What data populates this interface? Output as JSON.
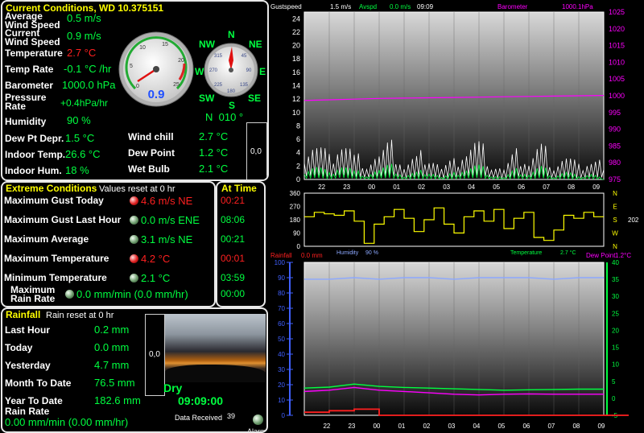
{
  "current": {
    "title": "Current Conditions, WD 10.375151",
    "avg_wind_label": "Average\nWind Speed",
    "avg_wind_value": "0.5 m/s",
    "cur_wind_label": "Current\nWind Speed",
    "cur_wind_value": "0.9 m/s",
    "temp_label": "Temperature",
    "temp_value": "2.7 °C",
    "temp_rate_label": "Temp Rate",
    "temp_rate_value": "-0.1 °C /hr",
    "baro_label": "Barometer",
    "baro_value": "1000.0 hPa",
    "pressure_rate_label": "Pressure\nRate",
    "pressure_rate_value": "+0.4hPa/hr",
    "humidity_label": "Humidity",
    "humidity_value": "90 %",
    "wind_dir_value": "N  010 °",
    "dewpt_label": "Dew Pt Depr.",
    "dewpt_value": "1.5 °C",
    "indoor_temp_label": "Indoor Temp.",
    "indoor_temp_value": "26.6 °C",
    "indoor_hum_label": "Indoor Hum.",
    "indoor_hum_value": "18 %",
    "wind_chill_label": "Wind chill",
    "wind_chill_value": "2.7 °C",
    "dew_point_label": "Dew Point",
    "dew_point_value": "1.2 °C",
    "wet_bulb_label": "Wet Bulb",
    "wet_bulb_value": "2.1 °C",
    "small_box_value": "0,0",
    "speed_gauge_value": "0.9",
    "speed_gauge_ticks": [
      "0",
      "5",
      "10",
      "15",
      "20",
      "25"
    ],
    "compass": {
      "n": "N",
      "ne": "NE",
      "e": "E",
      "se": "SE",
      "s": "S",
      "sw": "SW",
      "w": "W",
      "nw": "NW",
      "ticks": [
        "315",
        "45",
        "135",
        "225",
        "270",
        "90",
        "180"
      ]
    }
  },
  "extremes": {
    "title": "Extreme Conditions",
    "subtitle": "Values reset at 0 hr",
    "at_time_title": "At Time",
    "rows": [
      {
        "label": "Maximum Gust Today",
        "value": "4.6 m/s NE",
        "time": "00:21",
        "alert": true
      },
      {
        "label": "Maximum Gust Last Hour",
        "value": "0.0 m/s ENE",
        "time": "08:06",
        "alert": false
      },
      {
        "label": "Maximum Average",
        "value": "3.1 m/s NE",
        "time": "00:21",
        "alert": false
      },
      {
        "label": "Maximum Temperature",
        "value": "4.2 °C",
        "time": "00:01",
        "alert": true
      },
      {
        "label": "Minimum Temperature",
        "value": "2.1 °C",
        "time": "03:59",
        "alert": false
      },
      {
        "label": "Maximum\nRain Rate",
        "value": "0.0 mm/min (0.0 mm/hr)",
        "time": "00:00",
        "alert": false
      }
    ]
  },
  "rainfall": {
    "title": "Rainfall",
    "subtitle": "Rain reset at 0 hr",
    "last_hour_label": "Last Hour",
    "last_hour_value": "0.2 mm",
    "today_label": "Today",
    "today_value": "0.0 mm",
    "yesterday_label": "Yesterday",
    "yesterday_value": "4.7 mm",
    "month_label": "Month To Date",
    "month_value": "76.5 mm",
    "year_label": "Year To Date",
    "year_value": "182.6 mm",
    "rate_label": "Rain Rate",
    "rate_value": "0.00 mm/min (0.00 mm/hr)",
    "small_box_value": "0,0",
    "status": "Dry",
    "time": "09:09:00",
    "data_received_label": "Data Received",
    "data_received_value": "39",
    "alarm_label": "Alarm"
  },
  "colors": {
    "green": "#00ff40",
    "yellow": "#ffff00",
    "magenta": "#ff00ff",
    "red": "#ff2020",
    "blue": "#4060ff",
    "lightblue": "#8ca8ff"
  },
  "chart_data": [
    {
      "type": "line",
      "name": "wind-barometer",
      "legend": {
        "gust": "Gustspeed",
        "gust_value": "1.5 m/s",
        "avg": "Avspd",
        "avg_value": "0.0 m/s",
        "time": "09:09",
        "baro": "Barometer",
        "baro_value": "1000.1hPa"
      },
      "x_ticks": [
        "22",
        "23",
        "00",
        "01",
        "02",
        "03",
        "04",
        "05",
        "06",
        "07",
        "08",
        "09"
      ],
      "y_left": [
        0,
        2,
        4,
        6,
        8,
        10,
        12,
        14,
        16,
        18,
        20,
        22,
        24
      ],
      "y_right": [
        975,
        980,
        985,
        990,
        995,
        1000,
        1005,
        1010,
        1015,
        1020,
        1025
      ],
      "ylim_left": [
        0,
        25
      ],
      "ylim_right": [
        975,
        1025
      ],
      "series": [
        {
          "name": "Barometer",
          "axis": "right",
          "values": [
            998.6,
            998.8,
            999.0,
            999.2,
            999.3,
            999.4,
            999.5,
            999.6,
            999.7,
            999.8,
            999.9,
            1000.0,
            1000.1
          ]
        },
        {
          "name": "Gustspeed",
          "axis": "left",
          "values": [
            2.5,
            3.0,
            1.8,
            3.5,
            2.0,
            1.5,
            2.2,
            2.8,
            1.2,
            1.9,
            2.4,
            1.0,
            1.5,
            2.7,
            3.1,
            1.4,
            0.9,
            2.2,
            1.6,
            2.9,
            1.3,
            2.0,
            1.1,
            1.8,
            1.5
          ]
        },
        {
          "name": "Avspd",
          "axis": "left",
          "values": [
            0.8,
            1.2,
            0.5,
            1.4,
            0.7,
            0.4,
            0.9,
            1.1,
            0.3,
            0.6,
            0.8,
            0.2,
            0.5,
            1.0,
            1.2,
            0.4,
            0.2,
            0.8,
            0.5,
            1.1,
            0.3,
            0.7,
            0.2,
            0.6,
            0.0
          ]
        }
      ]
    },
    {
      "type": "line",
      "name": "wind-direction",
      "y_left": [
        0,
        90,
        180,
        270,
        360
      ],
      "y_right": [
        "N",
        "W",
        "S",
        "E",
        "N"
      ],
      "right_value": "202",
      "ylim": [
        0,
        360
      ],
      "series": [
        {
          "name": "Direction",
          "values": [
            200,
            230,
            220,
            210,
            240,
            170,
            20,
            150,
            200,
            250,
            190,
            100,
            180,
            260,
            150,
            90,
            200,
            240,
            170,
            250,
            120,
            190,
            230,
            60,
            40,
            110,
            210,
            190,
            230,
            200
          ]
        }
      ]
    },
    {
      "type": "line",
      "name": "temp-humidity-rain",
      "legend": {
        "rain": "Rainfall",
        "rain_value": "0.0 mm",
        "hum": "Humidity",
        "hum_value": "90 %",
        "temp": "Temperature",
        "temp_value": "2.7 °C",
        "dew": "Dew Point",
        "dew_value": "1.2°C"
      },
      "x_ticks": [
        "22",
        "23",
        "00",
        "01",
        "02",
        "03",
        "04",
        "05",
        "06",
        "07",
        "08",
        "09"
      ],
      "y_left": [
        0,
        10,
        20,
        30,
        40,
        50,
        60,
        70,
        80,
        90,
        100
      ],
      "y_right": [
        -5,
        0,
        5,
        10,
        15,
        20,
        25,
        30,
        35,
        40
      ],
      "ylim_left": [
        0,
        100
      ],
      "ylim_right": [
        -5,
        40
      ],
      "series": [
        {
          "name": "Humidity",
          "axis": "left",
          "values": [
            89,
            89,
            90,
            89,
            90,
            90,
            89,
            90,
            90,
            90,
            89,
            90,
            90
          ]
        },
        {
          "name": "Temperature",
          "axis": "right",
          "values": [
            3.0,
            3.3,
            4.2,
            3.5,
            3.2,
            3.0,
            2.8,
            2.6,
            2.4,
            2.5,
            2.6,
            2.7,
            2.7
          ]
        },
        {
          "name": "Dew Point",
          "axis": "right",
          "values": [
            2.0,
            2.4,
            3.2,
            2.4,
            2.0,
            1.6,
            1.2,
            1.0,
            1.2,
            1.3,
            1.2,
            1.2,
            1.2
          ]
        },
        {
          "name": "Rainfall",
          "axis": "left",
          "values": [
            2,
            3,
            4,
            0,
            0,
            0,
            0,
            0,
            0,
            0,
            0,
            0,
            0
          ]
        }
      ]
    }
  ]
}
